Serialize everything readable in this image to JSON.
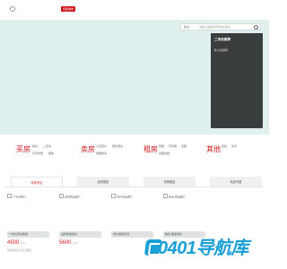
{
  "header": {
    "city_button": "切换城市"
  },
  "search": {
    "label": "新房：",
    "placeholder": "请输入楼盘名称/地址/板块"
  },
  "recommend": {
    "title": "二手房推荐",
    "item": "新小区推荐"
  },
  "categories": [
    {
      "title": "买房",
      "links": [
        "新房",
        "二手房",
        "打折优惠",
        "团购"
      ]
    },
    {
      "title": "卖房",
      "links": [
        "小区查价",
        "委托卖房",
        "我要卖房"
      ]
    },
    {
      "title": "租房",
      "links": [
        "整租",
        "写字楼",
        "合租",
        "商铺出租"
      ]
    },
    {
      "title": "其他",
      "links": [
        "问答",
        "资讯"
      ]
    }
  ],
  "tabs": [
    "特惠专区",
    "品质楼盘",
    "热销楼盘",
    "精选专题"
  ],
  "listings": [
    {
      "thumb": "广告位图片",
      "name": "广告位测试楼盘",
      "price": "4500",
      "unit": "元/m²",
      "addr": "测试地址信息 暂无楼盘"
    },
    {
      "thumb": "品牌楼盘图片",
      "name": "品牌楼盘测试",
      "price": "5600",
      "unit": "元/m²",
      "addr": ""
    },
    {
      "thumb": "特价楼盘图片",
      "name": "特价楼盘测试",
      "price": "",
      "unit": "",
      "addr": ""
    },
    {
      "thumb": "精选 楼盘图片",
      "name": "精选 楼盘测试",
      "price": "",
      "unit": "",
      "addr": ""
    }
  ],
  "watermark": "0401导航库"
}
